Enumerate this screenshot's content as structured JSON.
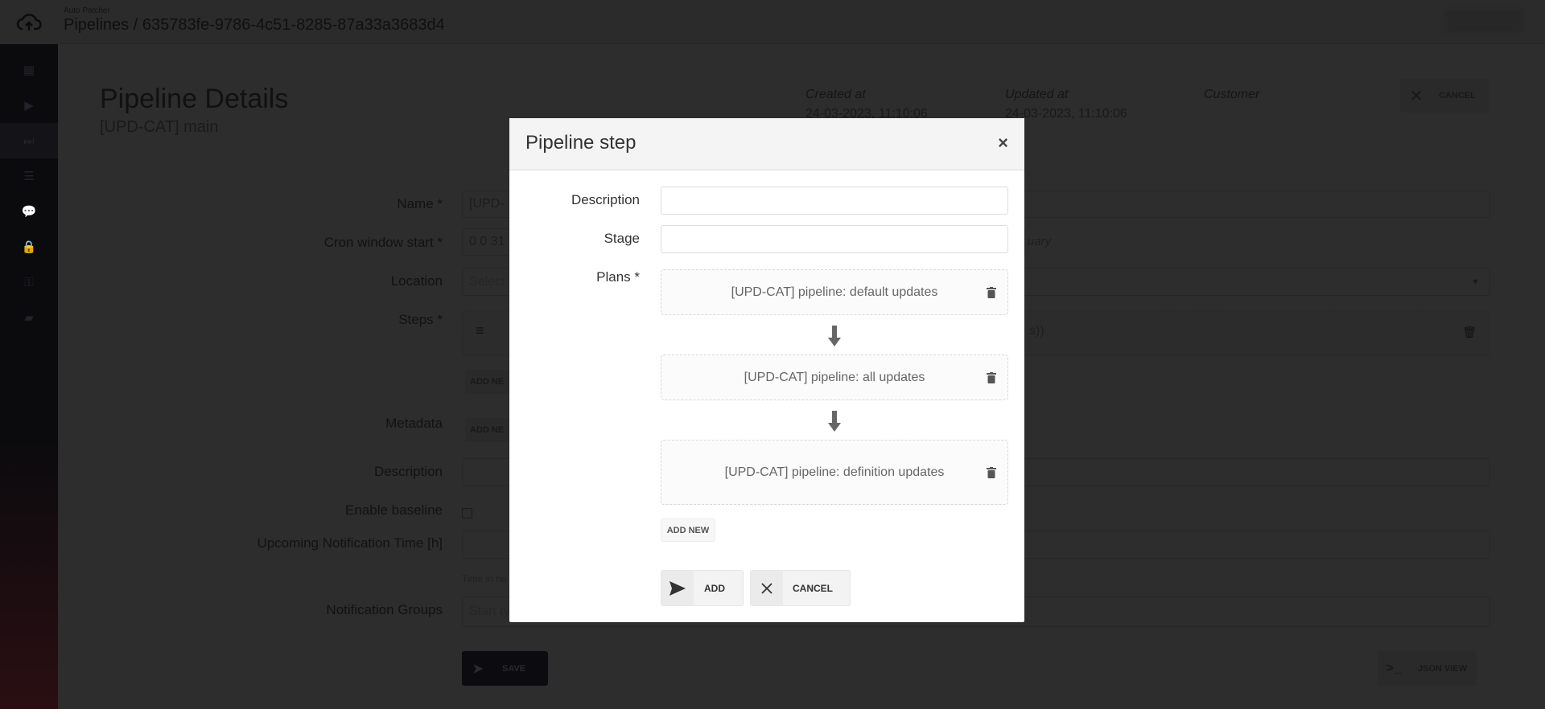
{
  "header": {
    "app_name": "Auto Patcher",
    "breadcrumb": "Pipelines / 635783fe-9786-4c51-8285-87a33a3683d4"
  },
  "sidebar": {
    "items": [
      {
        "icon": "calendar-icon"
      },
      {
        "icon": "play-icon"
      },
      {
        "icon": "step-forward-icon",
        "active": true
      },
      {
        "icon": "list-icon"
      },
      {
        "icon": "comments-icon"
      },
      {
        "icon": "lock-icon"
      },
      {
        "icon": "key-icon"
      },
      {
        "icon": "book-icon"
      }
    ]
  },
  "page": {
    "title": "Pipeline Details",
    "subtitle": "[UPD-CAT] main",
    "meta": [
      {
        "label": "Created at",
        "value": "24-03-2023, 11:10:06"
      },
      {
        "label": "Updated at",
        "value": "24-03-2023, 11:10:06"
      },
      {
        "label": "Customer",
        "value": ""
      }
    ],
    "cancel_label": "CANCEL",
    "form": {
      "name_label": "Name *",
      "name_value": "[UPD-",
      "cron_label": "Cron window start *",
      "cron_value": "0 0 31",
      "cron_hint": "uary",
      "location_label": "Location",
      "location_placeholder": "Select",
      "steps_label": "Steps *",
      "steps_text": "s))",
      "add_new": "ADD NE",
      "metadata_label": "Metadata",
      "description_label": "Description",
      "baseline_label": "Enable baseline",
      "baseline_checked": false,
      "upcoming_label": "Upcoming Notification Time [h]",
      "upcoming_hint": "Time in ho",
      "groups_label": "Notification Groups",
      "groups_placeholder": "Start ty"
    },
    "save_label": "SAVE",
    "json_view_label": "JSON VIEW"
  },
  "modal": {
    "title": "Pipeline step",
    "close": "×",
    "description_label": "Description",
    "description_value": "",
    "stage_label": "Stage",
    "stage_value": "",
    "plans_label": "Plans *",
    "plans": [
      "[UPD-CAT] pipeline: default updates",
      "[UPD-CAT] pipeline: all updates",
      "[UPD-CAT] pipeline: definition updates"
    ],
    "add_new_label": "ADD NEW",
    "add_label": "ADD",
    "cancel_label": "CANCEL"
  }
}
